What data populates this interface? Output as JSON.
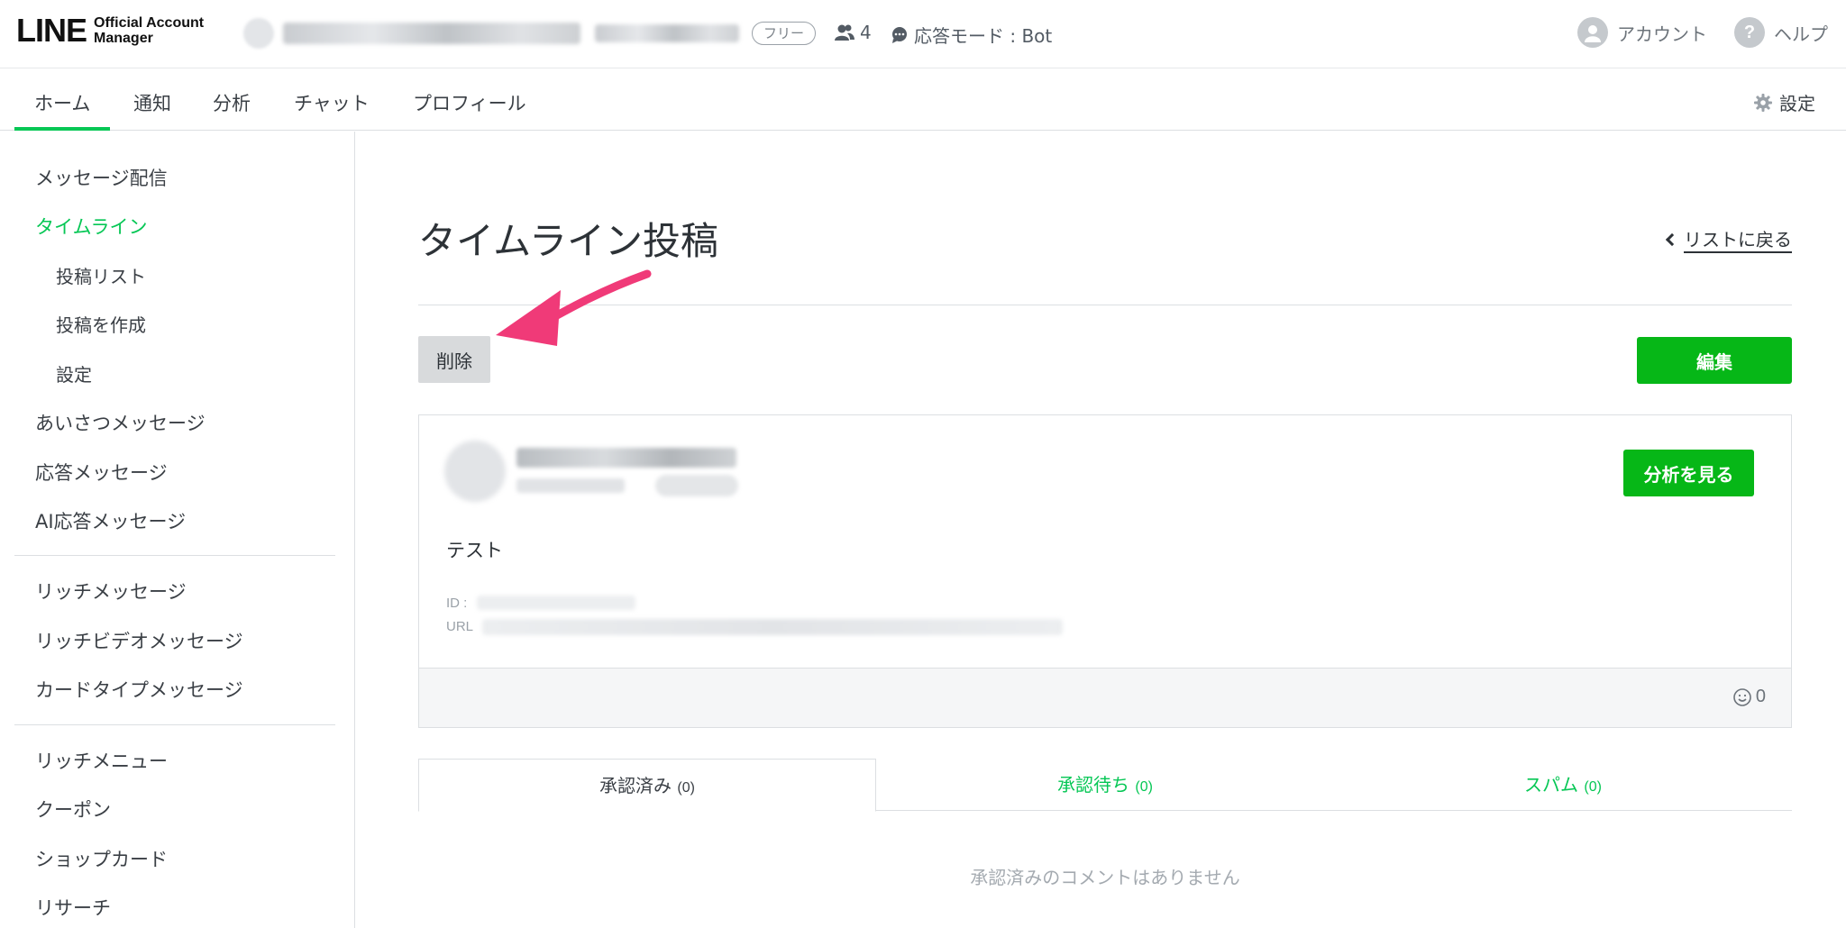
{
  "header": {
    "logo_main": "LINE",
    "logo_sub_line1": "Official Account",
    "logo_sub_line2": "Manager",
    "plan_badge": "フリー",
    "friends_count": "4",
    "response_mode": "応答モード : Bot",
    "account_label": "アカウント",
    "help_label": "ヘルプ",
    "help_glyph": "?"
  },
  "nav": {
    "tabs": [
      {
        "label": "ホーム",
        "active": true
      },
      {
        "label": "通知"
      },
      {
        "label": "分析"
      },
      {
        "label": "チャット"
      },
      {
        "label": "プロフィール"
      }
    ],
    "settings_label": "設定"
  },
  "sidebar": {
    "items": [
      {
        "label": "メッセージ配信"
      },
      {
        "label": "タイムライン",
        "active": true
      },
      {
        "label": "投稿リスト"
      },
      {
        "label": "投稿を作成"
      },
      {
        "label": "設定"
      },
      {
        "label": "あいさつメッセージ"
      },
      {
        "label": "応答メッセージ"
      },
      {
        "label": "AI応答メッセージ"
      },
      {
        "label": "リッチメッセージ"
      },
      {
        "label": "リッチビデオメッセージ"
      },
      {
        "label": "カードタイプメッセージ"
      },
      {
        "label": "リッチメニュー"
      },
      {
        "label": "クーポン"
      },
      {
        "label": "ショップカード"
      },
      {
        "label": "リサーチ"
      }
    ]
  },
  "main": {
    "title": "タイムライン投稿",
    "back_link": "リストに戻る",
    "delete_button": "削除",
    "edit_button": "編集",
    "post": {
      "text": "テスト",
      "id_label": "ID :",
      "url_label": "URL",
      "analytics_button": "分析を見る",
      "reaction_count": "0"
    },
    "comment_tabs": [
      {
        "label": "承認済み",
        "count": "(0)",
        "active": true
      },
      {
        "label": "承認待ち",
        "count": "(0)"
      },
      {
        "label": "スパム",
        "count": "(0)"
      }
    ],
    "empty_message": "承認済みのコメントはありません"
  },
  "colors": {
    "brand_green": "#06c755",
    "button_green": "#06b717",
    "annotation_arrow": "#f03a78"
  }
}
